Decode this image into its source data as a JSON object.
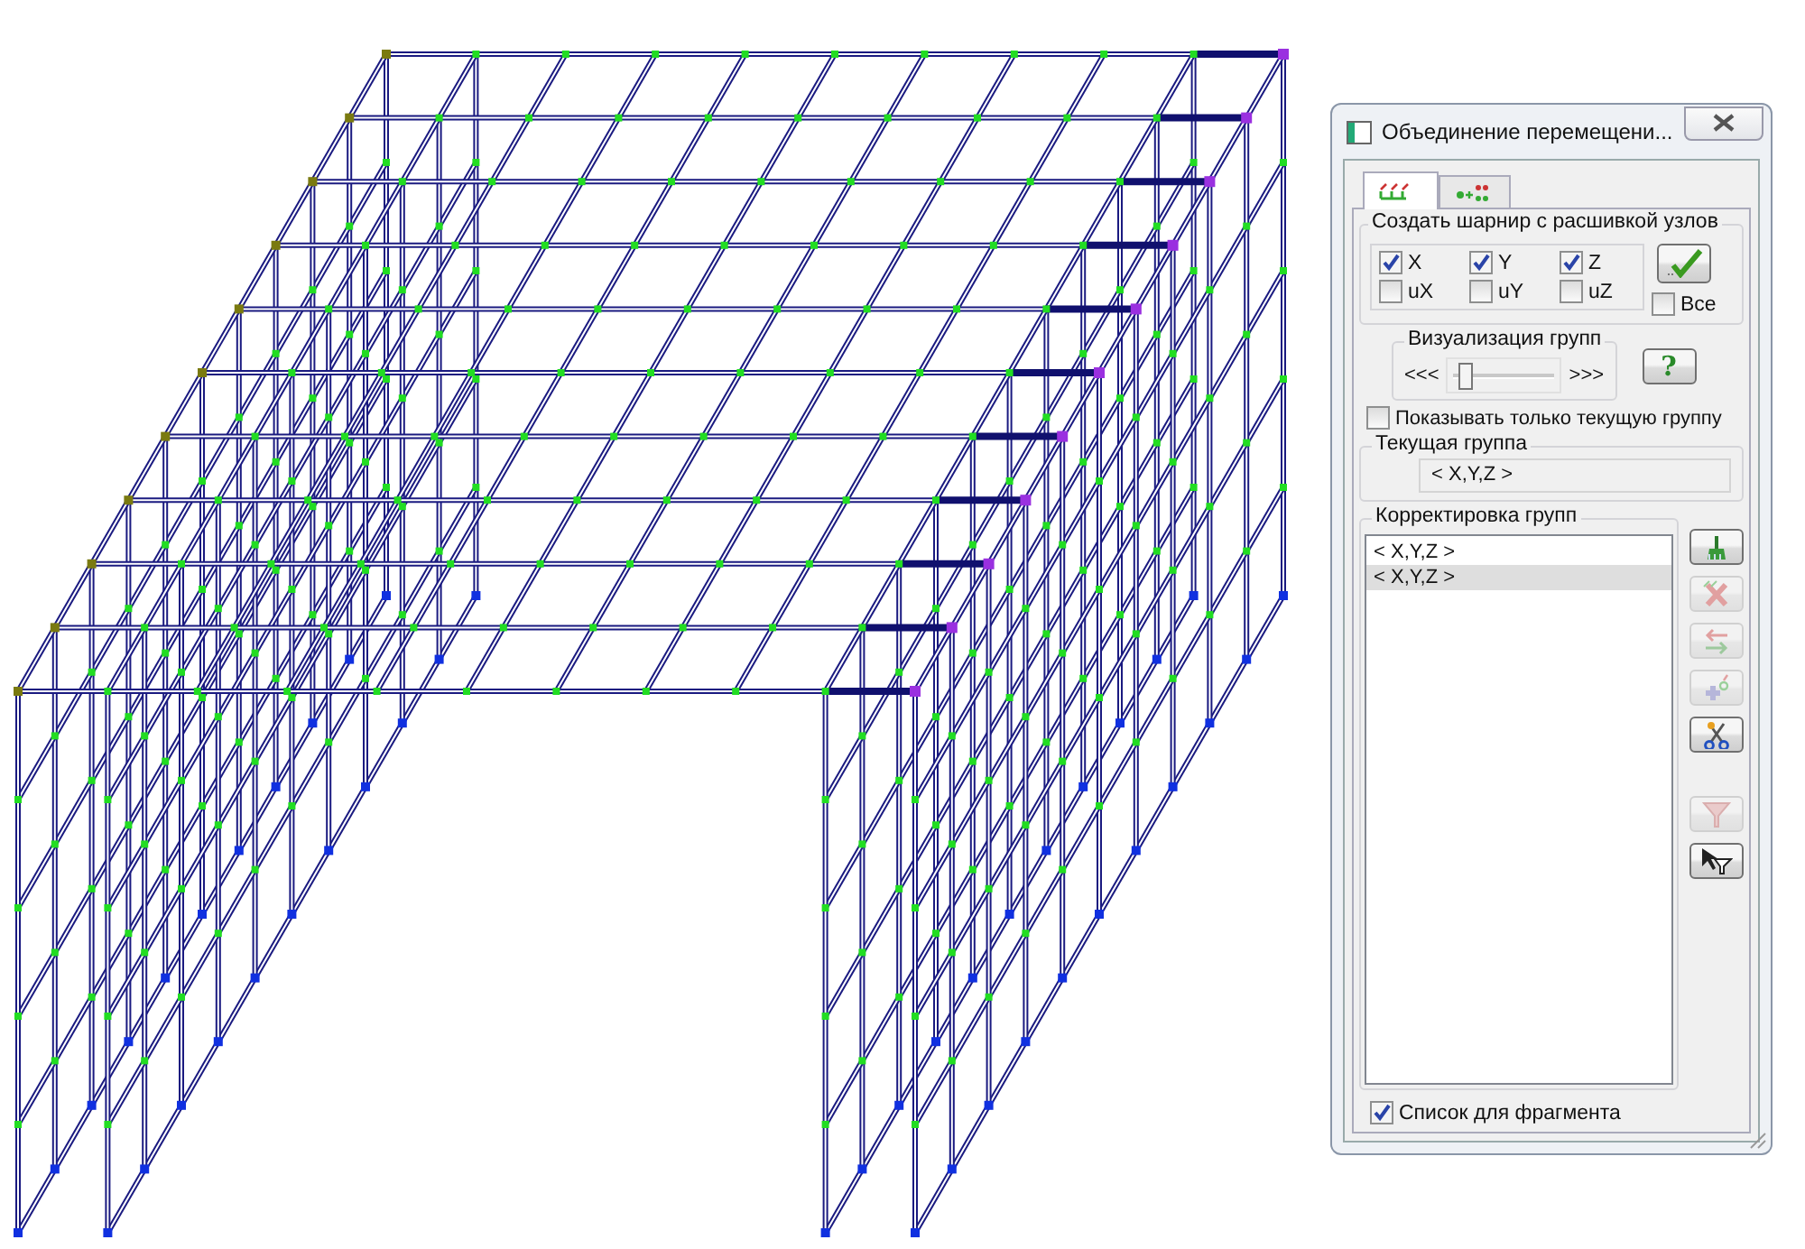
{
  "dialog": {
    "title": "Объединение перемещени...",
    "tabs": [
      {
        "kind": "hinge",
        "selected": true
      },
      {
        "kind": "merge",
        "selected": false
      }
    ],
    "hinge_group": {
      "title": "Создать шарнир с расшивкой узлов",
      "checkboxes": [
        {
          "label": "X",
          "checked": true
        },
        {
          "label": "Y",
          "checked": true
        },
        {
          "label": "Z",
          "checked": true
        },
        {
          "label": "uX",
          "checked": false
        },
        {
          "label": "uY",
          "checked": false
        },
        {
          "label": "uZ",
          "checked": false
        }
      ],
      "all": {
        "label": "Все",
        "checked": false
      }
    },
    "visualization": {
      "title": "Визуализация групп",
      "left": "<<<",
      "right": ">>>",
      "level": 0.05
    },
    "help_button": "?",
    "show_current_only": {
      "label": "Показывать только текущую группу",
      "checked": false
    },
    "current_group": {
      "title": "Текущая группа",
      "value": "< X,Y,Z >"
    },
    "groups": {
      "title": "Корректировка групп",
      "items": [
        {
          "text": "< X,Y,Z >",
          "selected": false
        },
        {
          "text": "< X,Y,Z >",
          "selected": true
        }
      ],
      "tools": [
        {
          "kind": "brush",
          "disabled": false
        },
        {
          "kind": "delete",
          "disabled": true
        },
        {
          "kind": "swap",
          "disabled": true
        },
        {
          "kind": "add",
          "disabled": true
        },
        {
          "kind": "cut",
          "disabled": false
        }
      ],
      "filter_tools": [
        {
          "kind": "filter",
          "disabled": true
        },
        {
          "kind": "pick-filter",
          "disabled": false
        }
      ]
    },
    "fragment_list": {
      "label": "Список для фрагмента",
      "checked": true
    }
  }
}
